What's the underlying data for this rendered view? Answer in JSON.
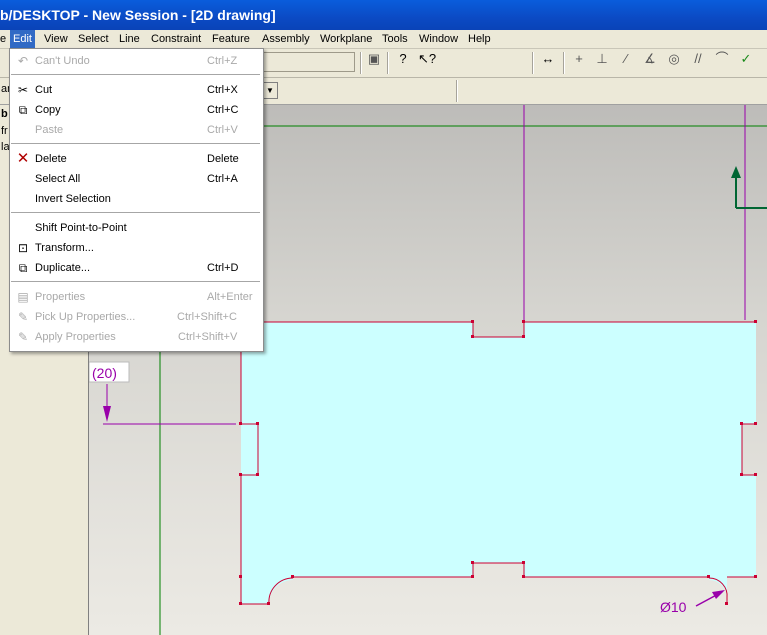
{
  "window": {
    "title": "b/DESKTOP - New Session - [2D drawing]"
  },
  "menubar": {
    "items": [
      "e",
      "Edit",
      "View",
      "Select",
      "Line",
      "Constraint",
      "Feature",
      "Assembly",
      "Workplane",
      "Tools",
      "Window",
      "Help"
    ],
    "active": "Edit"
  },
  "edit_menu": {
    "items": [
      {
        "label": "Can't Undo",
        "shortcut": "Ctrl+Z",
        "icon": "undo-icon",
        "disabled": true
      },
      {
        "label": "Cut",
        "shortcut": "Ctrl+X",
        "icon": "scissors-icon",
        "disabled": false
      },
      {
        "label": "Copy",
        "shortcut": "Ctrl+C",
        "icon": "copy-icon",
        "disabled": false
      },
      {
        "label": "Paste",
        "shortcut": "Ctrl+V",
        "icon": "",
        "disabled": true
      },
      {
        "label": "Delete",
        "shortcut": "Delete",
        "icon": "delete-x-icon",
        "disabled": false
      },
      {
        "label": "Select All",
        "shortcut": "Ctrl+A",
        "icon": "",
        "disabled": false
      },
      {
        "label": "Invert Selection",
        "shortcut": "",
        "icon": "",
        "disabled": false
      },
      {
        "label": "Shift Point-to-Point",
        "shortcut": "",
        "icon": "",
        "disabled": false
      },
      {
        "label": "Transform...",
        "shortcut": "",
        "icon": "transform-icon",
        "disabled": false
      },
      {
        "label": "Duplicate...",
        "shortcut": "Ctrl+D",
        "icon": "duplicate-icon",
        "disabled": false
      },
      {
        "label": "Properties",
        "shortcut": "Alt+Enter",
        "icon": "properties-icon",
        "disabled": true
      },
      {
        "label": "Pick Up Properties...",
        "shortcut": "Ctrl+Shift+C",
        "icon": "pickup-icon",
        "disabled": true
      },
      {
        "label": "Apply Properties",
        "shortcut": "Ctrl+Shift+V",
        "icon": "apply-icon",
        "disabled": true
      }
    ]
  },
  "left_panel": {
    "lines": [
      "b",
      "fr",
      "la"
    ],
    "combo_value": "ar"
  },
  "drawing": {
    "dimension_vertical": "(20)",
    "dimension_diameter": "Ø10"
  },
  "colors": {
    "part_fill": "#ccffff",
    "outline": "#cc0033",
    "dimension": "#9900aa",
    "axis": "#008000"
  }
}
